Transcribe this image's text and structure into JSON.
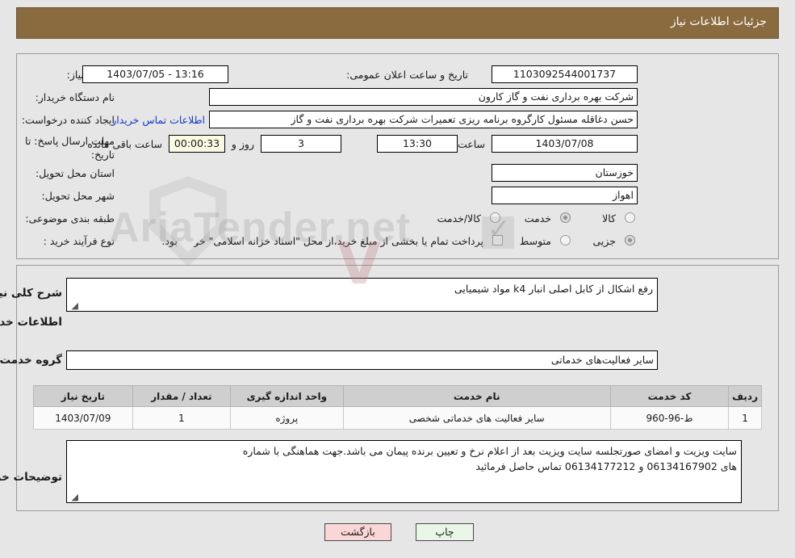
{
  "header": {
    "title": "جزئیات اطلاعات نیاز",
    "bar_color": "#8a6a3f"
  },
  "watermark": {
    "text": "AriaTender.net"
  },
  "top_section": {
    "need_number": {
      "label": "شماره نیاز:",
      "value": "1103092544001737"
    },
    "announce_datetime": {
      "label": "تاریخ و ساعت اعلان عمومی:",
      "value": "13:16 - 1403/07/05"
    },
    "buyer_org": {
      "label": "نام دستگاه خریدار:",
      "value": "شرکت بهره برداری نفت و گاز کارون"
    },
    "request_creator": {
      "label": "ایجاد کننده درخواست:",
      "value": "حسن دغاقله مسئول کارگروه برنامه ریزی تعمیرات شرکت بهره برداری نفت و گاز",
      "contact_link": "اطلاعات تماس خریدار"
    },
    "deadline": {
      "label_line1": "مهلت ارسال پاسخ: تا",
      "label_line2": "تاریخ:",
      "date": "1403/07/08",
      "hour_label": "ساعت",
      "hour": "13:30",
      "days": "3",
      "days_label": "روز و",
      "countdown": "00:00:33",
      "remaining_label": "ساعت باقی مانده"
    },
    "delivery_province": {
      "label": "استان محل تحویل:",
      "value": "خوزستان"
    },
    "delivery_city": {
      "label": "شهر محل تحویل:",
      "value": "اهواز"
    },
    "subject_category": {
      "label": "طبقه بندی موضوعی:",
      "options": [
        {
          "label": "کالا",
          "selected": false
        },
        {
          "label": "خدمت",
          "selected": true
        },
        {
          "label": "کالا/خدمت",
          "selected": false
        }
      ]
    },
    "purchase_process": {
      "label": "نوع فرآیند خرید :",
      "options": [
        {
          "label": "جزیی",
          "selected": true
        },
        {
          "label": "متوسط",
          "selected": false
        }
      ],
      "treasury_note": "پرداخت تمام یا بخشی از مبلغ خرید،از محل \"اسناد خزانه اسلامی\" خواهد بود.",
      "treasury_checked": false
    }
  },
  "mid_section": {
    "need_description": {
      "label": "شرح کلی نیاز:",
      "value": "رفع اشکال از کابل اصلی انبار k4 مواد شیمیایی"
    },
    "services_heading": "اطلاعات خدمات مورد نیاز",
    "service_group": {
      "label": "گروه خدمت:",
      "value": "سایر فعالیت‌های خدماتی"
    },
    "table": {
      "columns": [
        "ردیف",
        "کد خدمت",
        "نام خدمت",
        "واحد اندازه گیری",
        "تعداد / مقدار",
        "تاریخ نیاز"
      ],
      "rows": [
        {
          "row_no": "1",
          "service_code": "ط-96-960",
          "service_name": "سایر فعالیت های خدماتی شخصی",
          "unit": "پروژه",
          "quantity": "1",
          "need_date": "1403/07/09"
        }
      ]
    },
    "buyer_notes": {
      "label": "توضیحات خریدار:",
      "line1": "سایت ویزیت و امضای صورتجلسه سایت ویزیت بعد از اعلام نرخ و تعیین برنده پیمان می باشد.جهت هماهنگی با شماره",
      "line2": "های       06134167902 و 06134177212   تماس حاصل فرمائید"
    }
  },
  "footer": {
    "print_button": "چاپ",
    "back_button": "بازگشت"
  }
}
